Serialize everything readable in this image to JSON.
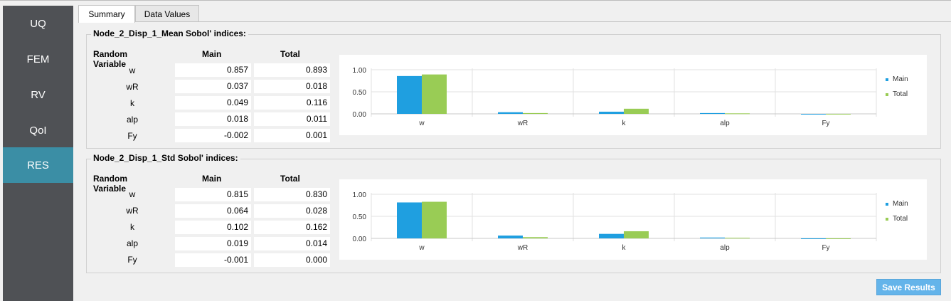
{
  "sidebar": {
    "items": [
      {
        "label": "UQ",
        "active": false
      },
      {
        "label": "FEM",
        "active": false
      },
      {
        "label": "RV",
        "active": false
      },
      {
        "label": "QoI",
        "active": false
      },
      {
        "label": "RES",
        "active": true
      }
    ]
  },
  "tabs": [
    {
      "label": "Summary",
      "active": true
    },
    {
      "label": "Data Values",
      "active": false
    }
  ],
  "groups": [
    {
      "title": "Node_2_Disp_1_Mean Sobol' indices:",
      "headers": {
        "rv": "Random Variable",
        "main": "Main",
        "total": "Total"
      },
      "rows": [
        {
          "rv": "w",
          "main": "0.857",
          "total": "0.893"
        },
        {
          "rv": "wR",
          "main": "0.037",
          "total": "0.018"
        },
        {
          "rv": "k",
          "main": "0.049",
          "total": "0.116"
        },
        {
          "rv": "alp",
          "main": "0.018",
          "total": "0.011"
        },
        {
          "rv": "Fy",
          "main": "-0.002",
          "total": "0.001"
        }
      ]
    },
    {
      "title": "Node_2_Disp_1_Std Sobol' indices:",
      "headers": {
        "rv": "Random Variable",
        "main": "Main",
        "total": "Total"
      },
      "rows": [
        {
          "rv": "w",
          "main": "0.815",
          "total": "0.830"
        },
        {
          "rv": "wR",
          "main": "0.064",
          "total": "0.028"
        },
        {
          "rv": "k",
          "main": "0.102",
          "total": "0.162"
        },
        {
          "rv": "alp",
          "main": "0.019",
          "total": "0.014"
        },
        {
          "rv": "Fy",
          "main": "-0.001",
          "total": "0.000"
        }
      ]
    }
  ],
  "chart_data": [
    {
      "type": "bar",
      "categories": [
        "w",
        "wR",
        "k",
        "alp",
        "Fy"
      ],
      "series": [
        {
          "name": "Main",
          "values": [
            0.857,
            0.037,
            0.049,
            0.018,
            -0.002
          ],
          "color": "#1f9fe0"
        },
        {
          "name": "Total",
          "values": [
            0.893,
            0.018,
            0.116,
            0.011,
            0.001
          ],
          "color": "#99cc55"
        }
      ],
      "yticks": [
        "1.00",
        "0.50",
        "0.00"
      ],
      "ylim": [
        0,
        1
      ],
      "grid": true,
      "legend": "right"
    },
    {
      "type": "bar",
      "categories": [
        "w",
        "wR",
        "k",
        "alp",
        "Fy"
      ],
      "series": [
        {
          "name": "Main",
          "values": [
            0.815,
            0.064,
            0.102,
            0.019,
            -0.001
          ],
          "color": "#1f9fe0"
        },
        {
          "name": "Total",
          "values": [
            0.83,
            0.028,
            0.162,
            0.014,
            0.0
          ],
          "color": "#99cc55"
        }
      ],
      "yticks": [
        "1.00",
        "0.50",
        "0.00"
      ],
      "ylim": [
        0,
        1
      ],
      "grid": true,
      "legend": "right"
    }
  ],
  "save_button": {
    "label": "Save Results"
  }
}
